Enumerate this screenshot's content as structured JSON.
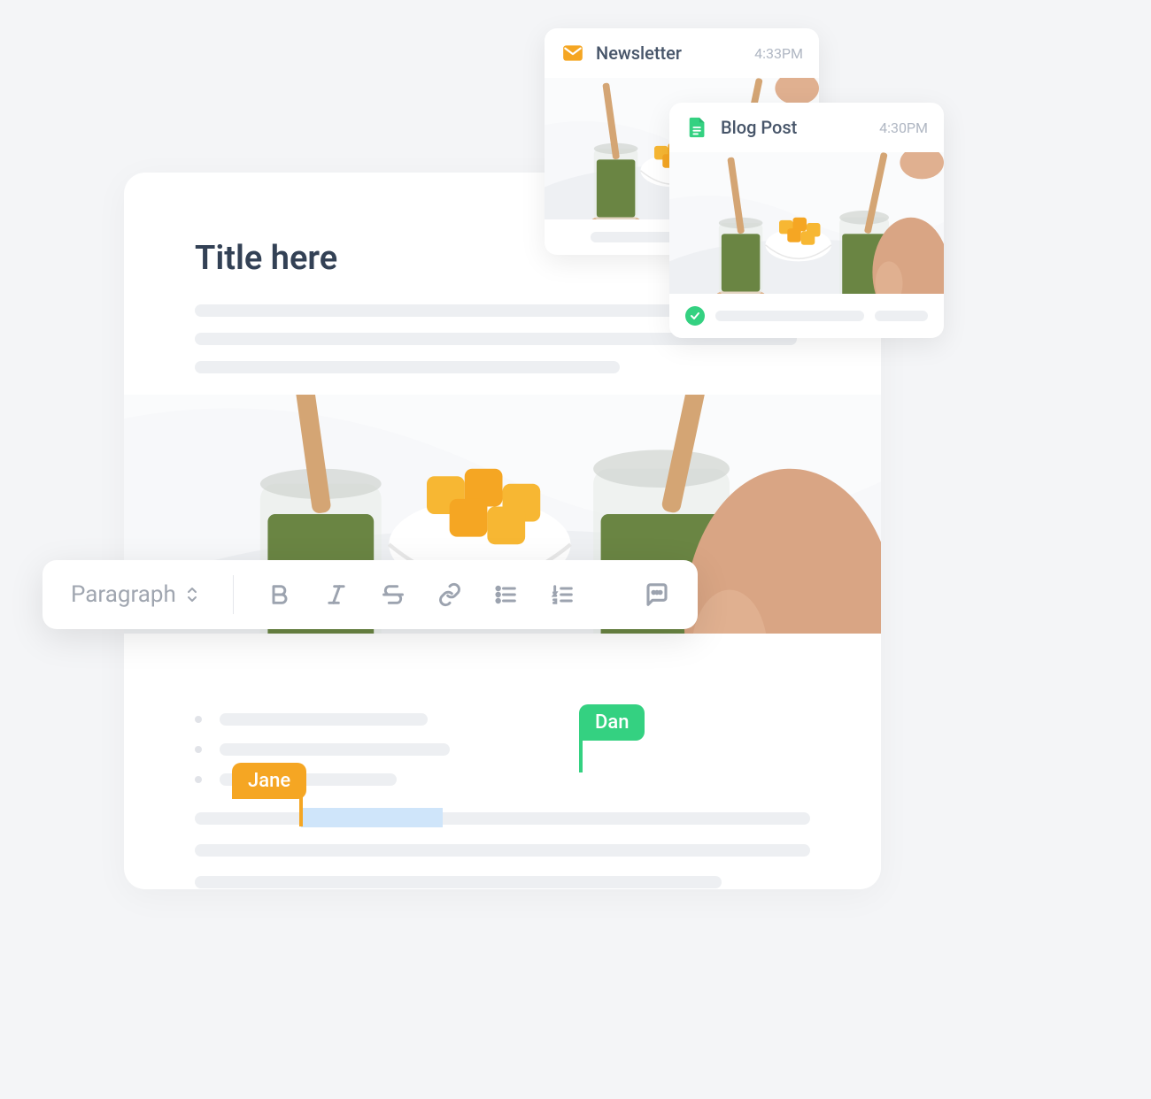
{
  "editor": {
    "title": "Title here"
  },
  "toolbar": {
    "style_label": "Paragraph"
  },
  "collaborators": {
    "dan": "Dan",
    "jane": "Jane"
  },
  "notifications": [
    {
      "icon": "mail-icon",
      "title": "Newsletter",
      "time": "4:33PM",
      "status": "none"
    },
    {
      "icon": "doc-icon",
      "title": "Blog Post",
      "time": "4:30PM",
      "status": "check"
    }
  ],
  "colors": {
    "green": "#34d181",
    "amber": "#f5a623",
    "blue_highlight": "#cfe5fa"
  }
}
